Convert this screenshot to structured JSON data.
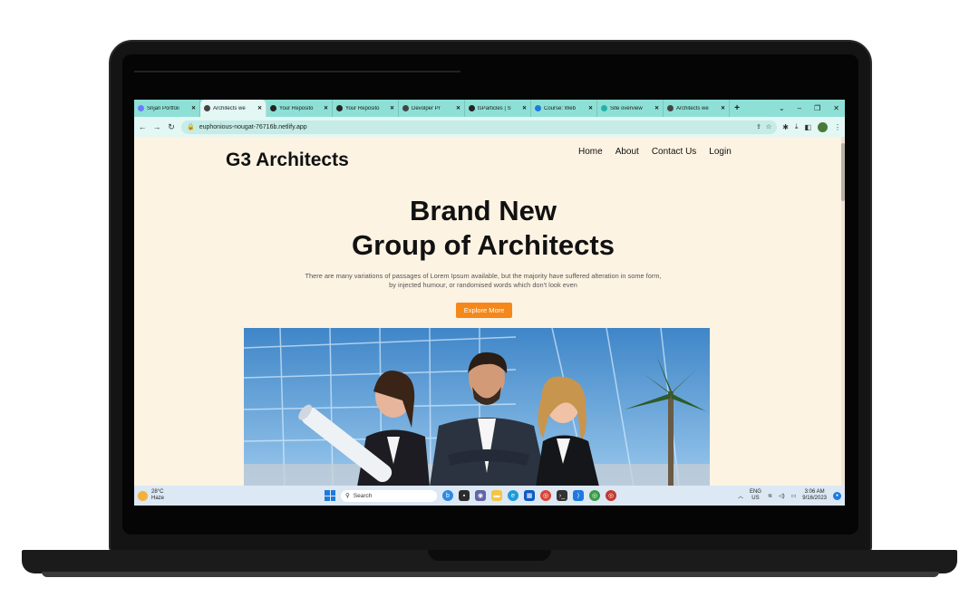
{
  "browser": {
    "tabs": [
      {
        "title": "Srijan Portfoli",
        "favicon": "globe-icon",
        "color": "#6b7cff"
      },
      {
        "title": "Architects we",
        "favicon": "globe-icon",
        "color": "#444444",
        "active": true
      },
      {
        "title": "Your Reposito",
        "favicon": "github-icon",
        "color": "#222222"
      },
      {
        "title": "Your Reposito",
        "favicon": "github-icon",
        "color": "#222222"
      },
      {
        "title": "Devolper Pr",
        "favicon": "globe-icon",
        "color": "#444444"
      },
      {
        "title": "tsParticles | S",
        "favicon": "tsparticles-icon",
        "color": "#222222"
      },
      {
        "title": "Course: Web",
        "favicon": "course-icon",
        "color": "#1f7ae0"
      },
      {
        "title": "Site overview",
        "favicon": "netlify-icon",
        "color": "#20b3a8"
      },
      {
        "title": "Architects we",
        "favicon": "globe-icon",
        "color": "#444444"
      }
    ],
    "new_tab_label": "+",
    "url": "euphonious-nougat-76716b.netlify.app"
  },
  "page": {
    "brand": "G3 Architects",
    "nav": [
      "Home",
      "About",
      "Contact Us",
      "Login"
    ],
    "hero_title_line1": "Brand New",
    "hero_title_line2": "Group of Architects",
    "hero_subtitle": "There are many variations of passages of Lorem Ipsum available, but the majority have suffered alteration in some form, by injected humour, or randomised words which don't look even",
    "cta_label": "Explore More",
    "accent_color": "#f4881a"
  },
  "taskbar": {
    "temperature": "28°C",
    "weather": "Haze",
    "search_placeholder": "Search",
    "language": "ENG",
    "region": "US",
    "time": "3:06 AM",
    "date": "9/16/2023"
  }
}
